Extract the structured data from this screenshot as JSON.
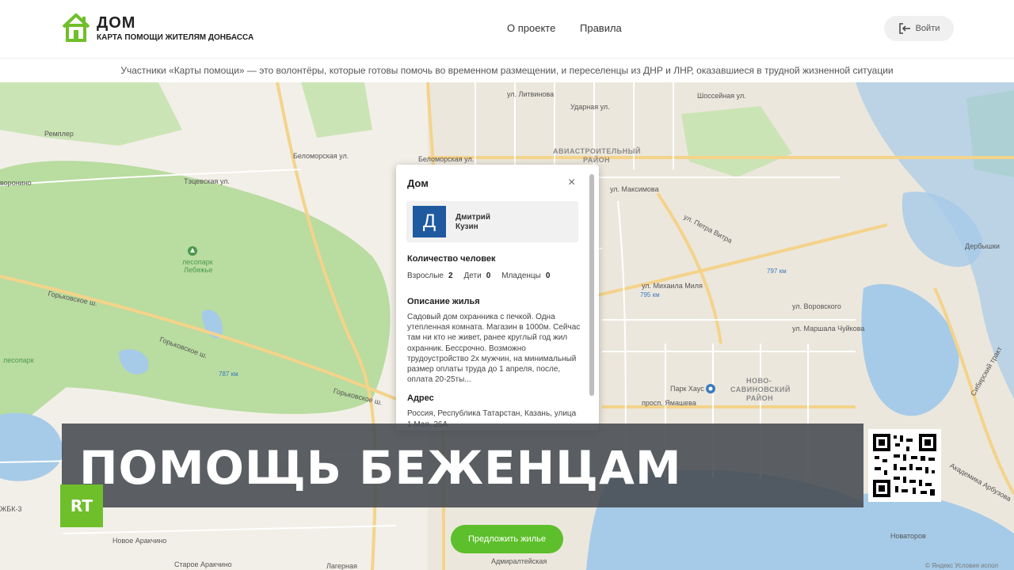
{
  "header": {
    "logo_title": "ДОМ",
    "logo_subtitle": "КАРТА ПОМОЩИ ЖИТЕЛЯМ ДОНБАССА",
    "nav": [
      {
        "label": "О проекте"
      },
      {
        "label": "Правила"
      }
    ],
    "login_label": "Войти"
  },
  "tagline": "Участники «Карты помощи» — это волонтёры, которые готовы помочь во временном размещении, и переселенцы из ДНР и ЛНР, оказавшиеся в трудной жизненной ситуации",
  "map": {
    "labels": {
      "rempler": "Ремплер",
      "lesopark": "лесопарк",
      "lebyazhye": "Лебяжье",
      "gorkovskoe1": "Горьковское ш.",
      "gorkovskoe2": "Горьковское ш.",
      "gorkovskoe3": "Горьковское ш.",
      "km787": "787 км",
      "km795": "795 км",
      "km797": "797 км",
      "belomorskaya1": "Беломорская ул.",
      "belomorskaya2": "Беломорская ул.",
      "aviastroitelny": "АВИАСТРОИТЕЛЬНЫЙ",
      "rayon1": "РАЙОН",
      "novosavinovsky": "НОВО-",
      "savinovsky": "САВИНОВСКИЙ",
      "rayon2": "РАЙОН",
      "maksimova": "ул. Максимова",
      "petra_vitra": "ул. Петра Витра",
      "sh_ulitsa": "Шоссейная ул.",
      "litvinova": "ул. Литвинова",
      "udarnaya": "Ударная ул.",
      "yamasheva": "просп. Ямашева",
      "park_house": "Парк Хаус",
      "marshala": "ул. Маршала Чуйкова",
      "vorovskogo": "ул. Воровского",
      "mikhaila": "ул. Михаила Миля",
      "derbyshki": "Дербышки",
      "novoe_arakchino": "Новое Аракчино",
      "staroe_arakchino": "Старое Аракчино",
      "lagernaya": "Лагерная",
      "admiralteyskaya": "Адмиралтейская",
      "novatorov": "Новаторов",
      "yabk": "ЖБК-3",
      "voronino": "воронино",
      "tyagovskaya": "Тэцевская ул.",
      "akademika": "Академика Арбузова",
      "sibirsky": "Сибирский тракт",
      "lesopark_left": "лесопарк"
    }
  },
  "popup": {
    "title": "Дом",
    "close_icon": "×",
    "owner_initial": "Д",
    "owner_first": "Дмитрий",
    "owner_last": "Кузин",
    "people_title": "Количество человек",
    "adults_label": "Взрослые",
    "adults_value": "2",
    "children_label": "Дети",
    "children_value": "0",
    "infants_label": "Младенцы",
    "infants_value": "0",
    "housing_title": "Описание жилья",
    "housing_text": "Садовый дом охранника с печкой. Одна утепленная комната. Магазин в 1000м. Сейчас там ни кто не живет, ранее круглый год жил охранник. Бессрочно. Возможно трудоустройство 2х мужчин, на минимальный размер оплаты труда до 1 апреля, после, оплата 20-25ты...",
    "address_title": "Адрес",
    "address_text": "Россия, Республика Татарстан, Казань, улица 1 Мая, 26А"
  },
  "overlay": {
    "banner_text": "ПОМОЩЬ БЕЖЕНЦАМ",
    "rt_label": "RT"
  },
  "offer_button_label": "Предложить жилье",
  "attribution": "© Яндекс Условия испол",
  "colors": {
    "accent_green": "#5dbf2b",
    "avatar_blue": "#1f5aa0",
    "map_green": "#b9dca0",
    "water": "#a6cbe8"
  }
}
